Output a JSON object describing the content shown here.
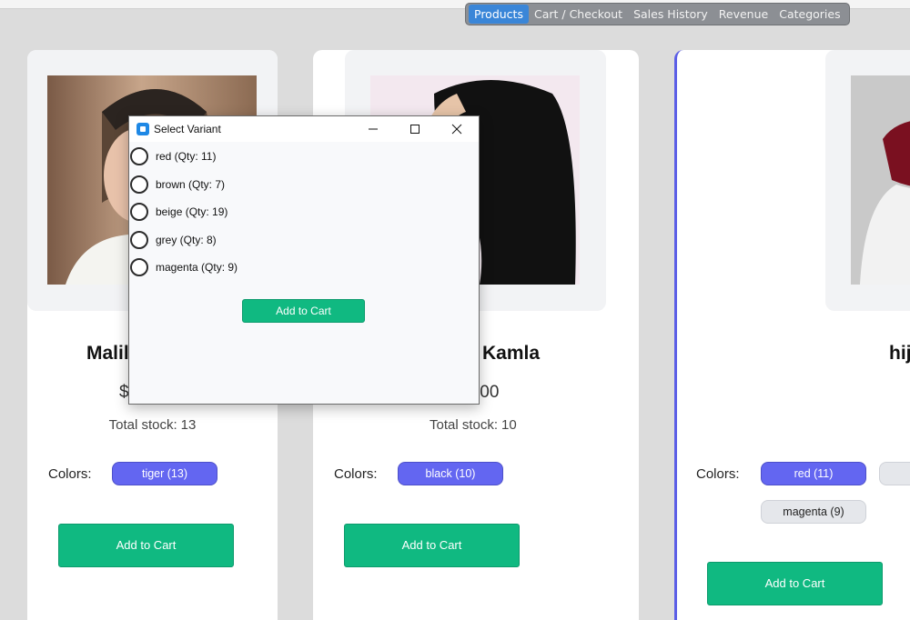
{
  "nav": {
    "items": [
      {
        "label": "Products",
        "active": true
      },
      {
        "label": "Cart / Checkout"
      },
      {
        "label": "Sales History"
      },
      {
        "label": "Revenue"
      },
      {
        "label": "Categories"
      }
    ]
  },
  "products": [
    {
      "name_visible": "Malil",
      "price_visible": "$",
      "stock_label": "Total stock:",
      "stock_value": "13",
      "colors_label": "Colors:",
      "colors": [
        {
          "label": "tiger (13)"
        }
      ],
      "add_label": "Add to Cart"
    },
    {
      "name_visible": "Kamla",
      "price_visible": ".00",
      "stock_label": "Total stock:",
      "stock_value": "10",
      "colors_label": "Colors:",
      "colors": [
        {
          "label": "black (10)"
        }
      ],
      "add_label": "Add to Cart"
    },
    {
      "name_visible": "hij",
      "colors_label": "Colors:",
      "colors": [
        {
          "label": "red (11)"
        },
        {
          "label": "b"
        },
        {
          "label": "magenta (9)"
        }
      ],
      "add_label": "Add to Cart"
    }
  ],
  "dialog": {
    "title": "Select Variant",
    "options": [
      {
        "label": "red (Qty: 11)"
      },
      {
        "label": "brown (Qty: 7)"
      },
      {
        "label": "beige (Qty: 19)"
      },
      {
        "label": "grey (Qty: 8)"
      },
      {
        "label": "magenta (Qty: 9)"
      }
    ],
    "add_label": "Add to Cart"
  },
  "colors": {
    "accent_green": "#10b981",
    "chip_indigo": "#6366f1",
    "nav_active": "#3a86d8",
    "selected_border": "#5b5ee6"
  }
}
